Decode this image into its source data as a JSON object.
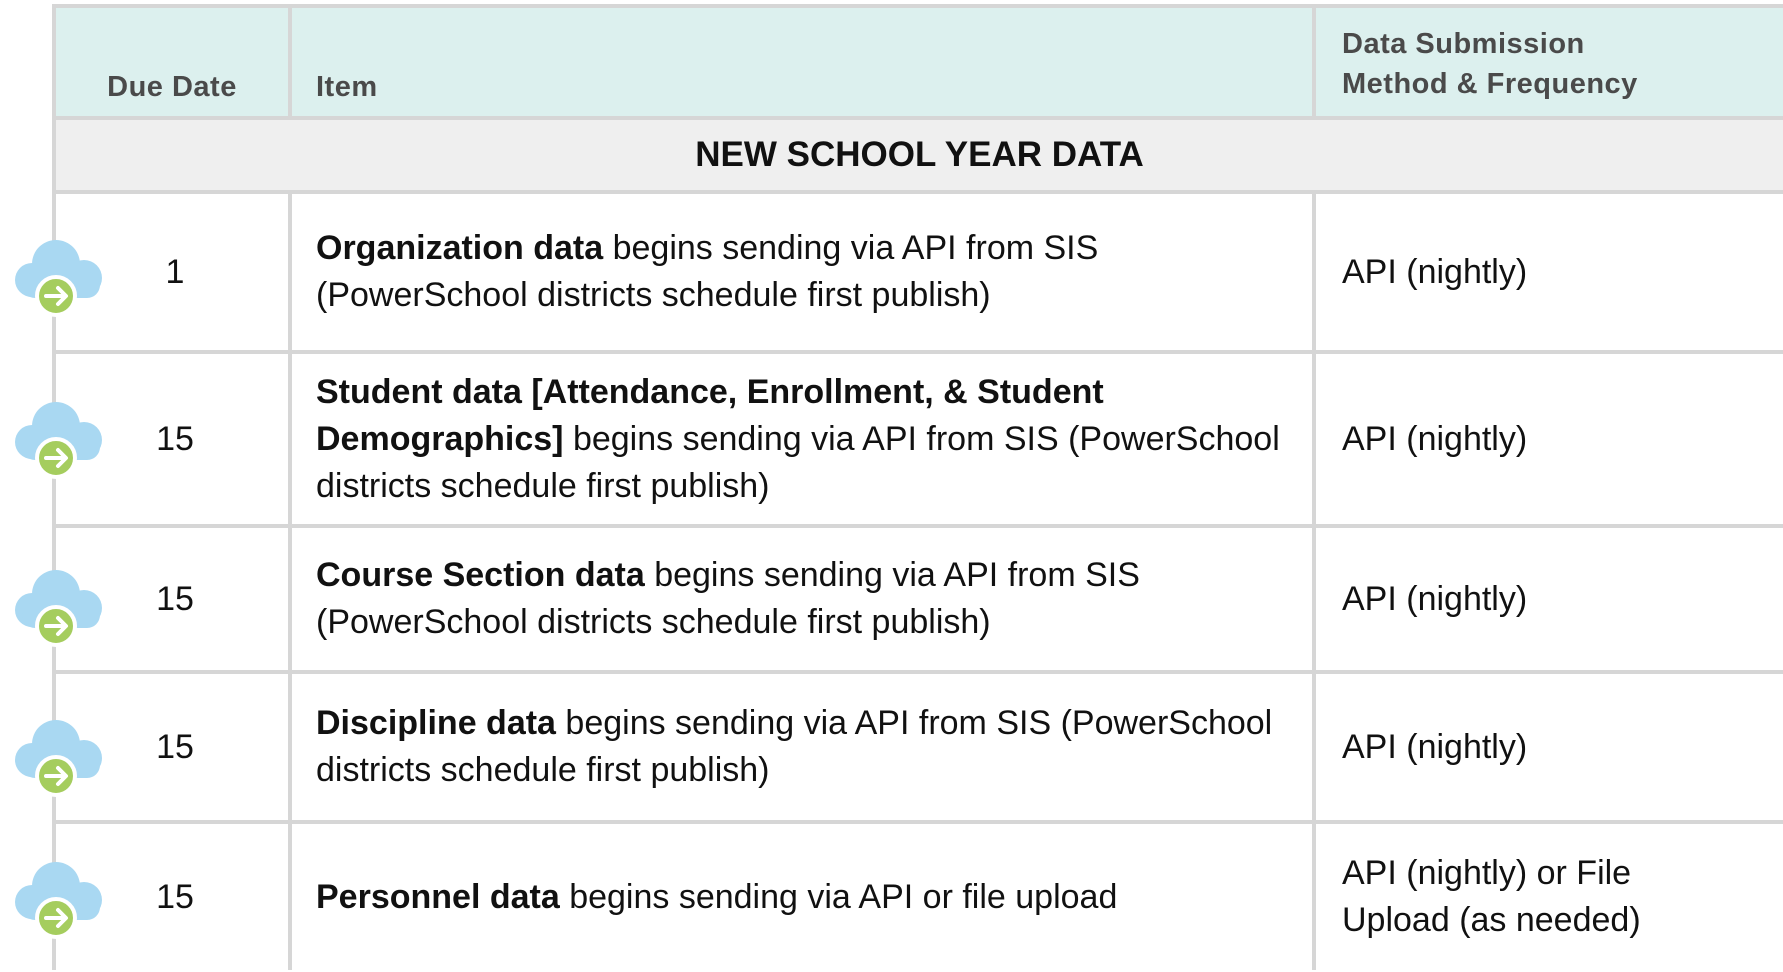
{
  "table": {
    "headers": {
      "due_date": "Due Date",
      "item": "Item",
      "method_line1": "Data Submission",
      "method_line2": "Method & Frequency"
    },
    "section_title": "NEW SCHOOL YEAR DATA",
    "rows": [
      {
        "due": "1",
        "bold": "Organization data",
        "text": " begins sending via API from SIS (PowerSchool districts schedule first publish)",
        "method": "API (nightly)",
        "icon": "cloud-upload-icon"
      },
      {
        "due": "15",
        "bold": "Student data [Attendance, Enrollment, & Student Demographics]",
        "text": " begins sending via API from SIS (PowerSchool districts schedule first publish)",
        "method": "API (nightly)",
        "icon": "cloud-upload-icon"
      },
      {
        "due": "15",
        "bold": "Course Section data",
        "text": " begins sending via API from SIS (PowerSchool districts schedule first publish)",
        "method": "API (nightly)",
        "icon": "cloud-upload-icon"
      },
      {
        "due": "15",
        "bold": "Discipline data",
        "text": " begins sending via API from SIS (PowerSchool districts schedule first publish)",
        "method": "API (nightly)",
        "icon": "cloud-upload-icon"
      },
      {
        "due": "15",
        "bold": "Personnel data",
        "text": " begins sending via API or file upload",
        "method": "API (nightly) or File Upload (as needed)",
        "icon": "cloud-upload-icon"
      }
    ]
  },
  "colors": {
    "header_bg": "#dcf0ee",
    "section_bg": "#efefef",
    "border": "#d6d6d6",
    "cloud": "#a9d8f2",
    "arrow_badge": "#a5cd5e"
  }
}
